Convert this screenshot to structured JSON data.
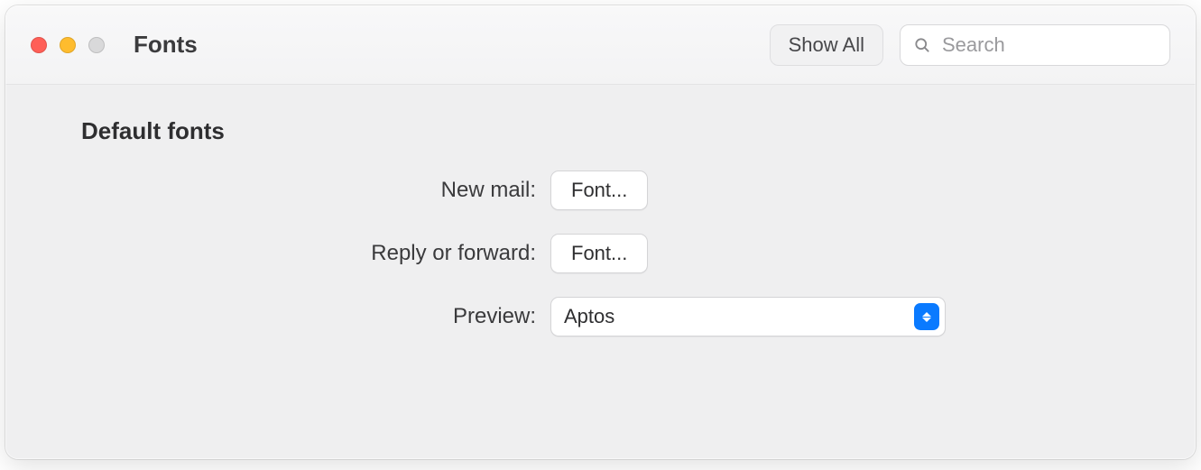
{
  "window": {
    "title": "Fonts"
  },
  "toolbar": {
    "show_all_label": "Show All",
    "search_placeholder": "Search"
  },
  "section": {
    "heading": "Default fonts",
    "rows": {
      "new_mail": {
        "label": "New mail:",
        "button": "Font..."
      },
      "reply": {
        "label": "Reply or forward:",
        "button": "Font..."
      },
      "preview": {
        "label": "Preview:",
        "value": "Aptos"
      }
    }
  }
}
